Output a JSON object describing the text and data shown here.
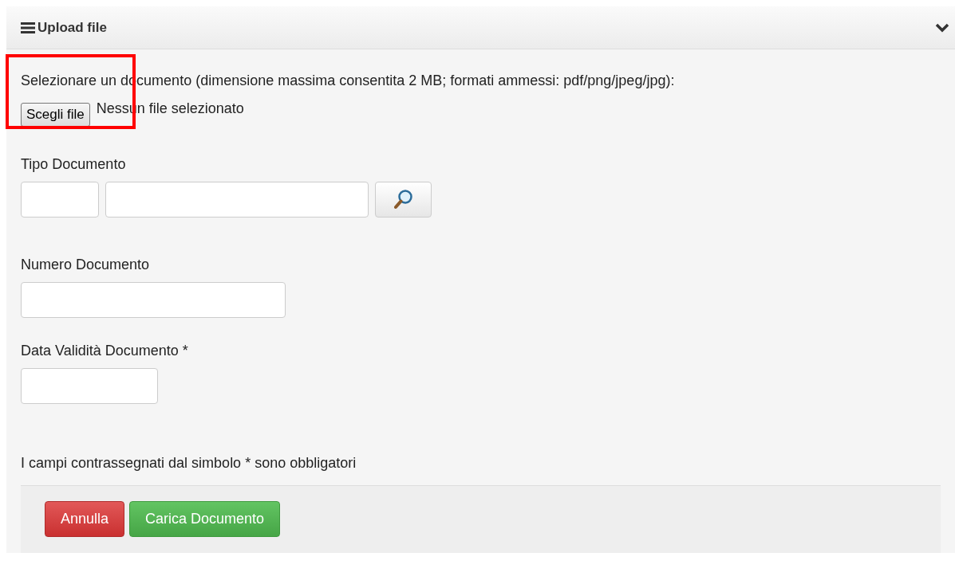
{
  "panel": {
    "title": "Upload file",
    "expanded": true
  },
  "instruction": "Selezionare un documento (dimensione massima consentita 2 MB; formati ammessi: pdf/png/jpeg/jpg):",
  "file_input": {
    "button": "Scegli file",
    "status": "Nessun file selezionato",
    "highlighted": true
  },
  "fields": [
    {
      "label": "Tipo Documento",
      "kind": "lookup"
    },
    {
      "label": "Numero Documento",
      "kind": "text"
    },
    {
      "label": "Data Validità Documento *",
      "kind": "date"
    }
  ],
  "note": "I campi contrassegnati dal simbolo * sono obbligatori",
  "buttons": [
    {
      "label": "Annulla",
      "kind": "danger"
    },
    {
      "label": "Carica Documento",
      "kind": "success"
    }
  ]
}
